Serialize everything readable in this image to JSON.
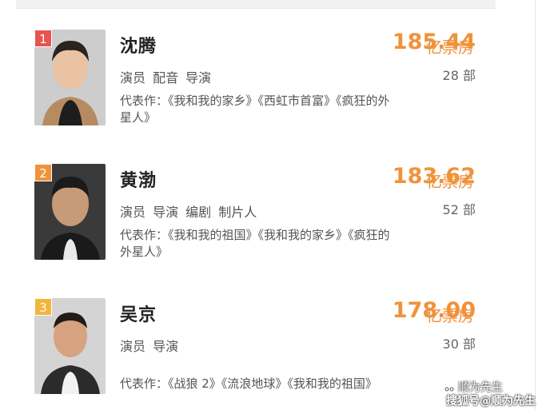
{
  "colors": {
    "accent": "#f0923a",
    "rank1": "#e8554e",
    "rank2": "#f0923a",
    "rank3": "#f2b63a"
  },
  "entries": [
    {
      "rank": "1",
      "name": "沈腾",
      "box_office": "185.44",
      "unit": "亿票房",
      "roles": "演员 配音 导演",
      "count": "28 部",
      "works_line1": "代表作：《我和我的家乡》《西虹市首富》《疯狂的外",
      "works_line2": "星人》"
    },
    {
      "rank": "2",
      "name": "黄渤",
      "box_office": "183.62",
      "unit": "亿票房",
      "roles": "演员 导演 编剧 制片人",
      "count": "52 部",
      "works_line1": "代表作：《我和我的祖国》《我和我的家乡》《疯狂的",
      "works_line2": "外星人》"
    },
    {
      "rank": "3",
      "name": "吴京",
      "box_office": "178.00",
      "unit": "亿票房",
      "roles": "演员 导演",
      "count": "30 部",
      "works_line1": "代表作：《战狼 2》《流浪地球》《我和我的祖国》",
      "works_line2": ""
    }
  ],
  "watermark": {
    "line1": "顺为先生",
    "line2": "搜狐号@顺为先生"
  }
}
